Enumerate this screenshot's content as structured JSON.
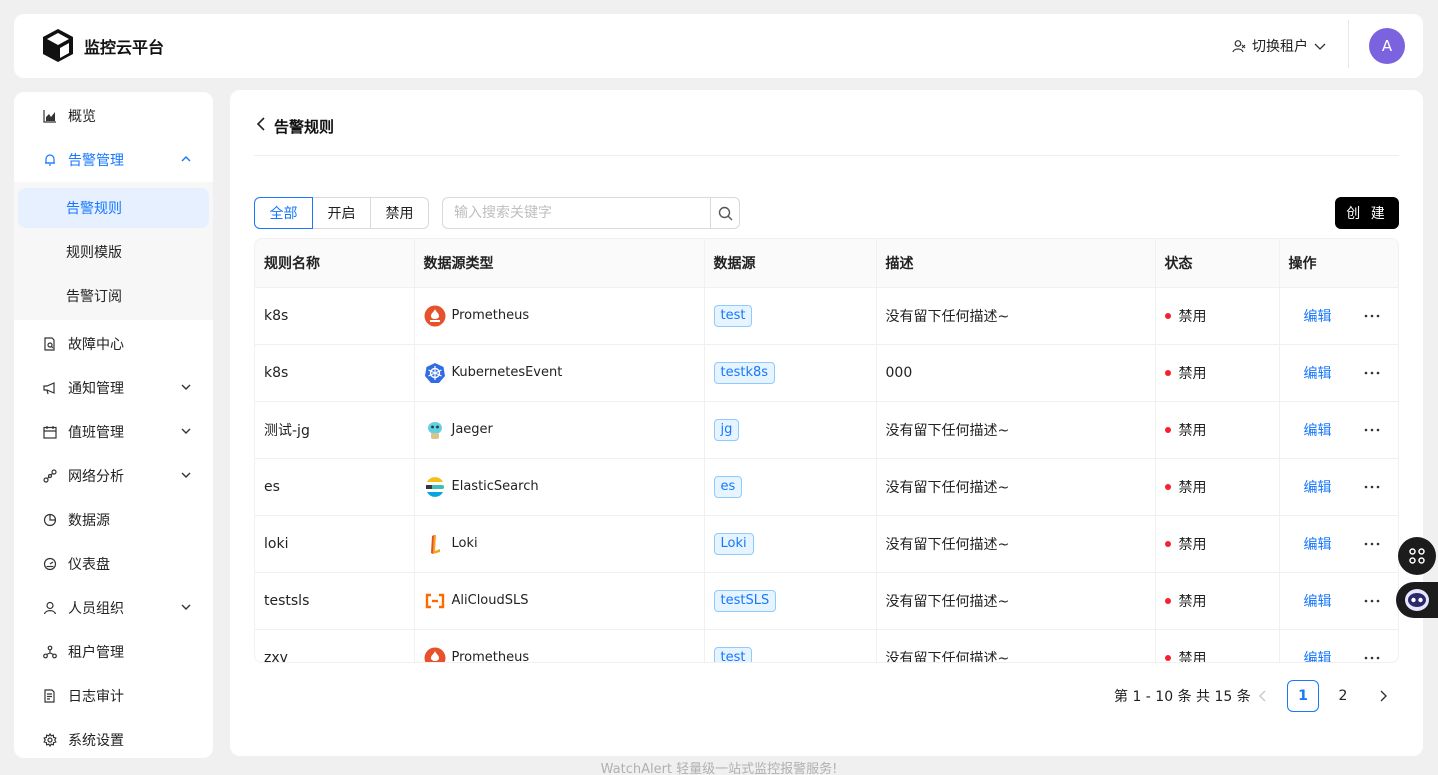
{
  "header": {
    "brand": "监控云平台",
    "tenant_label": "切换租户",
    "avatar_letter": "A"
  },
  "sidebar": {
    "items": [
      {
        "label": "概览",
        "icon": "area-chart-icon"
      },
      {
        "label": "告警管理",
        "icon": "bell-icon",
        "expanded": true
      },
      {
        "label": "故障中心",
        "icon": "file-search-icon"
      },
      {
        "label": "通知管理",
        "icon": "megaphone-icon"
      },
      {
        "label": "值班管理",
        "icon": "calendar-icon"
      },
      {
        "label": "网络分析",
        "icon": "network-icon"
      },
      {
        "label": "数据源",
        "icon": "pie-chart-icon"
      },
      {
        "label": "仪表盘",
        "icon": "dashboard-icon"
      },
      {
        "label": "人员组织",
        "icon": "user-icon"
      },
      {
        "label": "租户管理",
        "icon": "cluster-icon"
      },
      {
        "label": "日志审计",
        "icon": "audit-icon"
      },
      {
        "label": "系统设置",
        "icon": "gear-icon"
      }
    ],
    "sub_items": [
      {
        "label": "告警规则",
        "selected": true
      },
      {
        "label": "规则模版"
      },
      {
        "label": "告警订阅"
      }
    ]
  },
  "page": {
    "title": "告警规则",
    "filters": [
      "全部",
      "开启",
      "禁用"
    ],
    "active_filter": "全部",
    "search_placeholder": "输入搜索关键字",
    "create_label": "创 建"
  },
  "table": {
    "columns": [
      "规则名称",
      "数据源类型",
      "数据源",
      "描述",
      "状态",
      "操作"
    ],
    "rows": [
      {
        "name": "k8s",
        "type": "Prometheus",
        "type_icon": "prometheus-icon",
        "source": "test",
        "desc": "没有留下任何描述~",
        "status": "禁用",
        "action": "编辑"
      },
      {
        "name": "k8s",
        "type": "KubernetesEvent",
        "type_icon": "kubernetes-icon",
        "source": "testk8s",
        "desc": "000",
        "status": "禁用",
        "action": "编辑"
      },
      {
        "name": "测试-jg",
        "type": "Jaeger",
        "type_icon": "jaeger-icon",
        "source": "jg",
        "desc": "没有留下任何描述~",
        "status": "禁用",
        "action": "编辑"
      },
      {
        "name": "es",
        "type": "ElasticSearch",
        "type_icon": "elasticsearch-icon",
        "source": "es",
        "desc": "没有留下任何描述~",
        "status": "禁用",
        "action": "编辑"
      },
      {
        "name": "loki",
        "type": "Loki",
        "type_icon": "loki-icon",
        "source": "Loki",
        "desc": "没有留下任何描述~",
        "status": "禁用",
        "action": "编辑"
      },
      {
        "name": "testsls",
        "type": "AliCloudSLS",
        "type_icon": "alicloud-icon",
        "source": "testSLS",
        "desc": "没有留下任何描述~",
        "status": "禁用",
        "action": "编辑"
      },
      {
        "name": "zxv",
        "type": "Prometheus",
        "type_icon": "prometheus-icon",
        "source": "test",
        "desc": "没有留下任何描述~",
        "status": "禁用",
        "action": "编辑"
      }
    ]
  },
  "pagination": {
    "total_text": "第 1 - 10 条 共 15 条",
    "pages": [
      "1",
      "2"
    ],
    "current": "1"
  },
  "footer": "WatchAlert 轻量级一站式监控报警服务!",
  "colors": {
    "accent": "#1677ff",
    "status_disabled": "#f5222d",
    "avatar": "#7b63e0"
  }
}
